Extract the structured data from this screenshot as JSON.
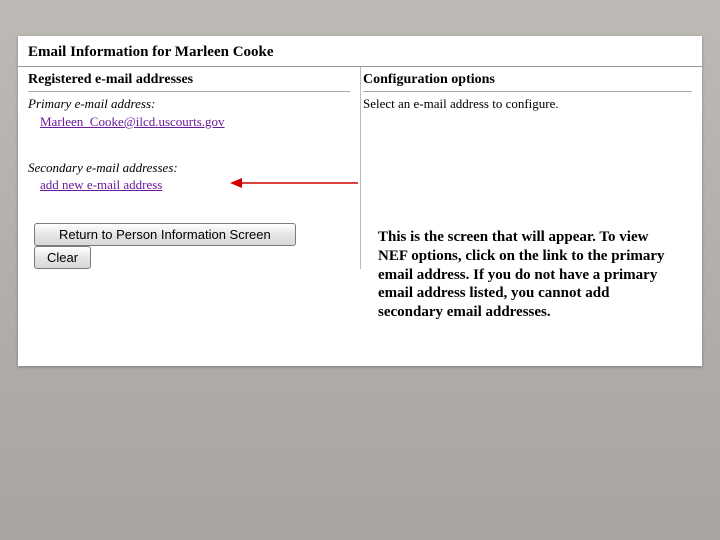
{
  "title": "Email Information for Marleen Cooke",
  "left": {
    "heading": "Registered e-mail addresses",
    "primary_label": "Primary e-mail address:",
    "primary_email": "Marleen_Cooke@ilcd.uscourts.gov",
    "secondary_label": "Secondary e-mail addresses:",
    "add_link": "add new e-mail address"
  },
  "right": {
    "heading": "Configuration options",
    "instruction": "Select an e-mail address to configure."
  },
  "buttons": {
    "return_label": "Return to Person Information Screen",
    "clear_label": "Clear"
  },
  "annotation": {
    "text": "This is the screen that will appear. To view NEF options, click on the link to the primary email address. If you do not have a primary email address listed, you cannot add secondary email addresses."
  }
}
